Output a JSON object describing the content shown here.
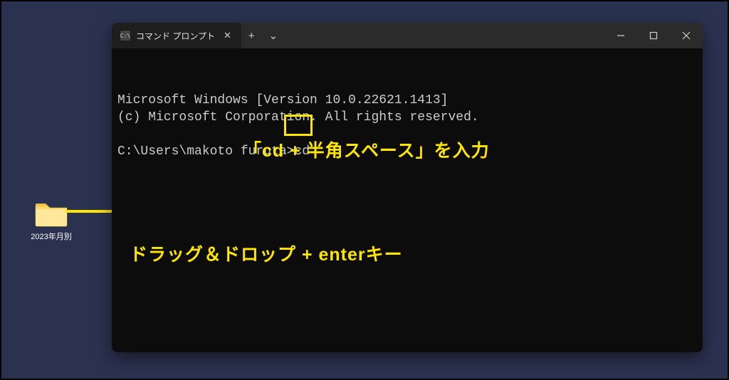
{
  "desktop": {
    "folder_label": "2023年月別"
  },
  "window": {
    "tab_title": "コマンド プロンプト",
    "tab_icon": "C:\\",
    "new_tab": "+",
    "dropdown": "⌄",
    "close_tab": "✕",
    "minimize": "—",
    "maximize": "▢",
    "close": "✕"
  },
  "terminal": {
    "line1": "Microsoft Windows [Version 10.0.22621.1413]",
    "line2": "(c) Microsoft Corporation. All rights reserved.",
    "prompt": "C:\\Users\\makoto furuta>",
    "command": "cd "
  },
  "annotations": {
    "cd_note": "「cd + 半角スペース」を入力",
    "dragdrop_note": "ドラッグ＆ドロップ + enterキー"
  }
}
